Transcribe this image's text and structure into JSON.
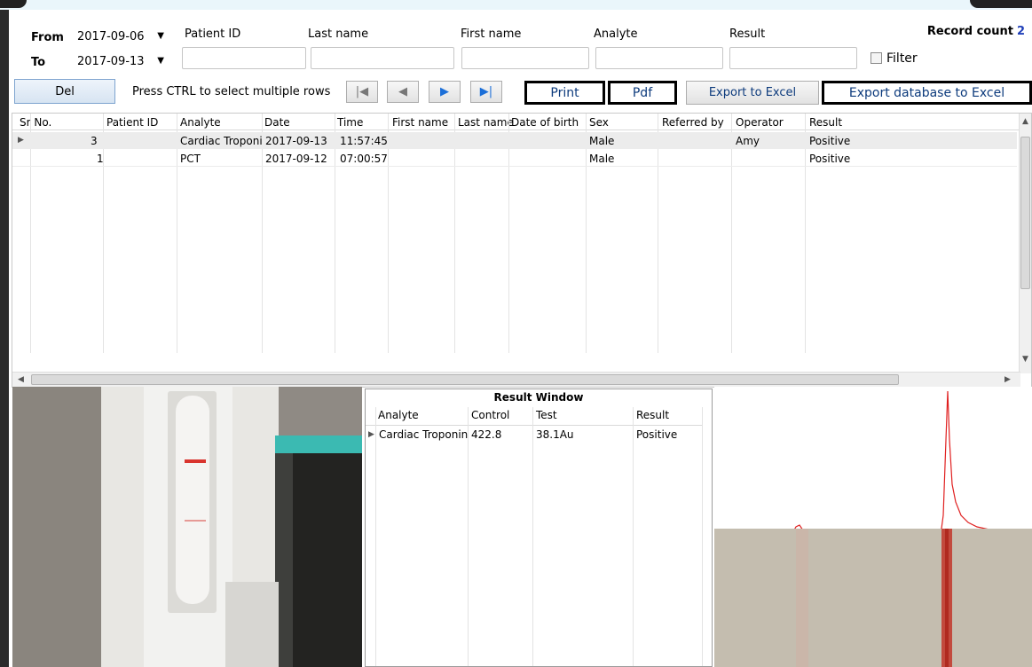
{
  "filter": {
    "from_label": "From",
    "to_label": "To",
    "from_date": "2017-09-06",
    "to_date": "2017-09-13",
    "patient_id_label": "Patient ID",
    "last_name_label": "Last name",
    "first_name_label": "First name",
    "analyte_label": "Analyte",
    "result_label": "Result",
    "record_count_label": "Record count",
    "record_count_value": "2",
    "filter_checkbox_label": "Filter"
  },
  "toolbar": {
    "del_label": "Del",
    "hint": "Press CTRL to select multiple rows",
    "nav_first": "|◀",
    "nav_prev": "◀",
    "nav_next": "▶",
    "nav_last": "▶|",
    "print_label": "Print",
    "pdf_label": "Pdf",
    "export_excel_label": "Export to Excel",
    "export_db_label": "Export database to Excel"
  },
  "grid": {
    "columns": [
      "Sr No.",
      "Patient ID",
      "Analyte",
      "Date",
      "Time",
      "First name",
      "Last name",
      "Date of birth",
      "Sex",
      "Referred by",
      "Operator",
      "Result"
    ],
    "rows": [
      {
        "sr": "3",
        "patient_id": "",
        "analyte": "Cardiac Troponin",
        "date": "2017-09-13",
        "time": "11:57:45",
        "first": "",
        "last": "",
        "dob": "",
        "sex": "Male",
        "ref": "",
        "operator": "Amy",
        "result": "Positive"
      },
      {
        "sr": "1",
        "patient_id": "",
        "analyte": "PCT",
        "date": "2017-09-12",
        "time": "07:00:57",
        "first": "",
        "last": "",
        "dob": "",
        "sex": "Male",
        "ref": "",
        "operator": "",
        "result": "Positive"
      }
    ]
  },
  "result_window": {
    "title": "Result Window",
    "columns": [
      "Analyte",
      "Control",
      "Test",
      "Result"
    ],
    "rows": [
      {
        "analyte": "Cardiac Troponin",
        "control": "422.8",
        "test": "38.1Au",
        "result": "Positive"
      }
    ]
  },
  "colors": {
    "signal_line": "#e02020",
    "link_blue": "#0c3a7c",
    "count_blue": "#1f3fb8"
  }
}
